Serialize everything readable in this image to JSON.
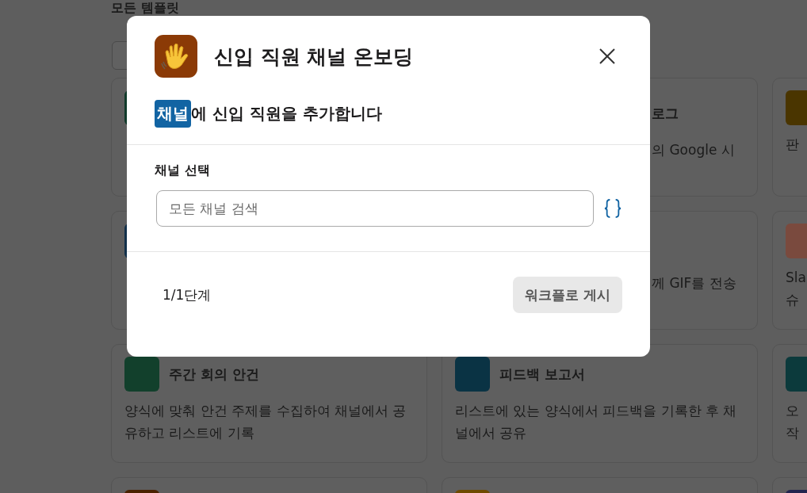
{
  "page": {
    "heading": "모든 템플릿",
    "cards": [
      {
        "kind": "covered",
        "color": "#103a2a"
      },
      {
        "kind": "behind-modal",
        "title": "로그",
        "description": [
          "의 Google 시"
        ]
      },
      {
        "kind": "edge",
        "color": "#4a3500",
        "description": [
          "판"
        ]
      },
      {
        "kind": "covered",
        "color": "#12304a"
      },
      {
        "kind": "behind-modal",
        "description": [
          "께 GIF를 전송"
        ]
      },
      {
        "kind": "edge",
        "color": "#7a4a3e",
        "description": [
          "Sla",
          "슈"
        ]
      },
      {
        "kind": "full",
        "color": "#12402c",
        "title": "주간 회의 안건",
        "description": [
          "양식에 맞춰 안건 주제를 수집하여 채널에서 공",
          "유하고 리스트에 기록"
        ]
      },
      {
        "kind": "full",
        "color": "#0a3344",
        "title": "피드백 보고서",
        "description": [
          "리스트에 있는 양식에서 피드백을 기록한 후 채",
          "널에서 공유"
        ]
      },
      {
        "kind": "edge",
        "color": "#0c3a3c",
        "description": [
          "오",
          "작"
        ]
      },
      {
        "kind": "full",
        "color": "#4a2200"
      },
      {
        "kind": "full",
        "color": "#6e4a00"
      },
      {
        "kind": "edge",
        "color": "#23254f"
      }
    ]
  },
  "dialog": {
    "title": "신입 직원 채널 온보딩",
    "subtitle": {
      "token": "채널",
      "text": "에 신입 직원을 추가합니다"
    },
    "field": {
      "label": "채널 선택",
      "placeholder": "모든 채널 검색"
    },
    "step": "1/1단계",
    "submit": {
      "label": "워크플로 게시",
      "disabled": true
    }
  }
}
